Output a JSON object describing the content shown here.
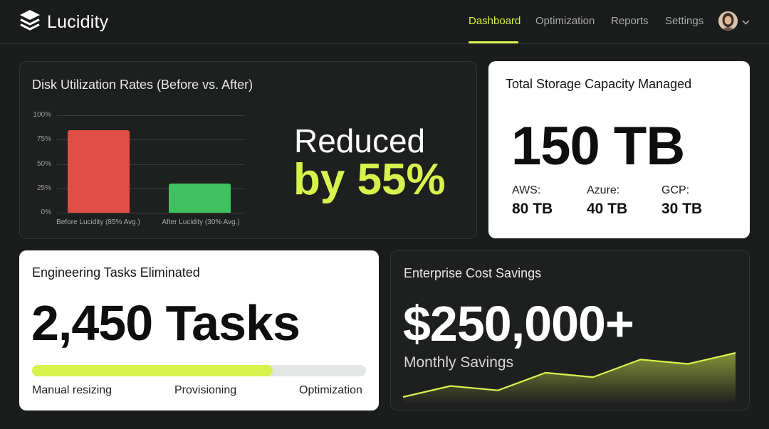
{
  "app": {
    "name": "Lucidity"
  },
  "nav": {
    "items": [
      {
        "label": "Dashboard",
        "active": true
      },
      {
        "label": "Optimization",
        "active": false
      },
      {
        "label": "Reports",
        "active": false
      },
      {
        "label": "Settings",
        "active": false
      }
    ]
  },
  "colors": {
    "accent": "#d7f24d",
    "before_bar": "#e04f45",
    "after_bar": "#3fc15f",
    "background": "#1b1c1c"
  },
  "disk_card": {
    "title": "Disk Utilization Rates (Before vs. After)",
    "headline_line1": "Reduced",
    "headline_line2": "by 55%"
  },
  "chart_data": {
    "type": "bar",
    "title": "Disk Utilization Rates (Before vs. After)",
    "categories": [
      "Before Lucidity (85% Avg.)",
      "After Lucidity (30% Avg.)"
    ],
    "values": [
      85,
      30
    ],
    "yticks": [
      "100%",
      "75%",
      "50%",
      "25%",
      "0%"
    ],
    "ylim": [
      0,
      100
    ],
    "grid": true
  },
  "storage_card": {
    "title": "Total Storage Capacity Managed",
    "total": "150 TB",
    "breakdown": [
      {
        "label": "AWS:",
        "value": "80 TB"
      },
      {
        "label": "Azure:",
        "value": "40 TB"
      },
      {
        "label": "GCP:",
        "value": "30 TB"
      }
    ]
  },
  "tasks_card": {
    "title": "Engineering Tasks Eliminated",
    "value": "2,450 Tasks",
    "progress": 0.72,
    "labels": [
      "Manual resizing",
      "Provisioning",
      "Optimization"
    ]
  },
  "savings_card": {
    "title": "Enterprise Cost Savings",
    "value": "$250,000+",
    "subtitle": "Monthly Savings",
    "trend": [
      0.0,
      0.25,
      0.15,
      0.55,
      0.45,
      0.85,
      0.75,
      1.0
    ]
  }
}
